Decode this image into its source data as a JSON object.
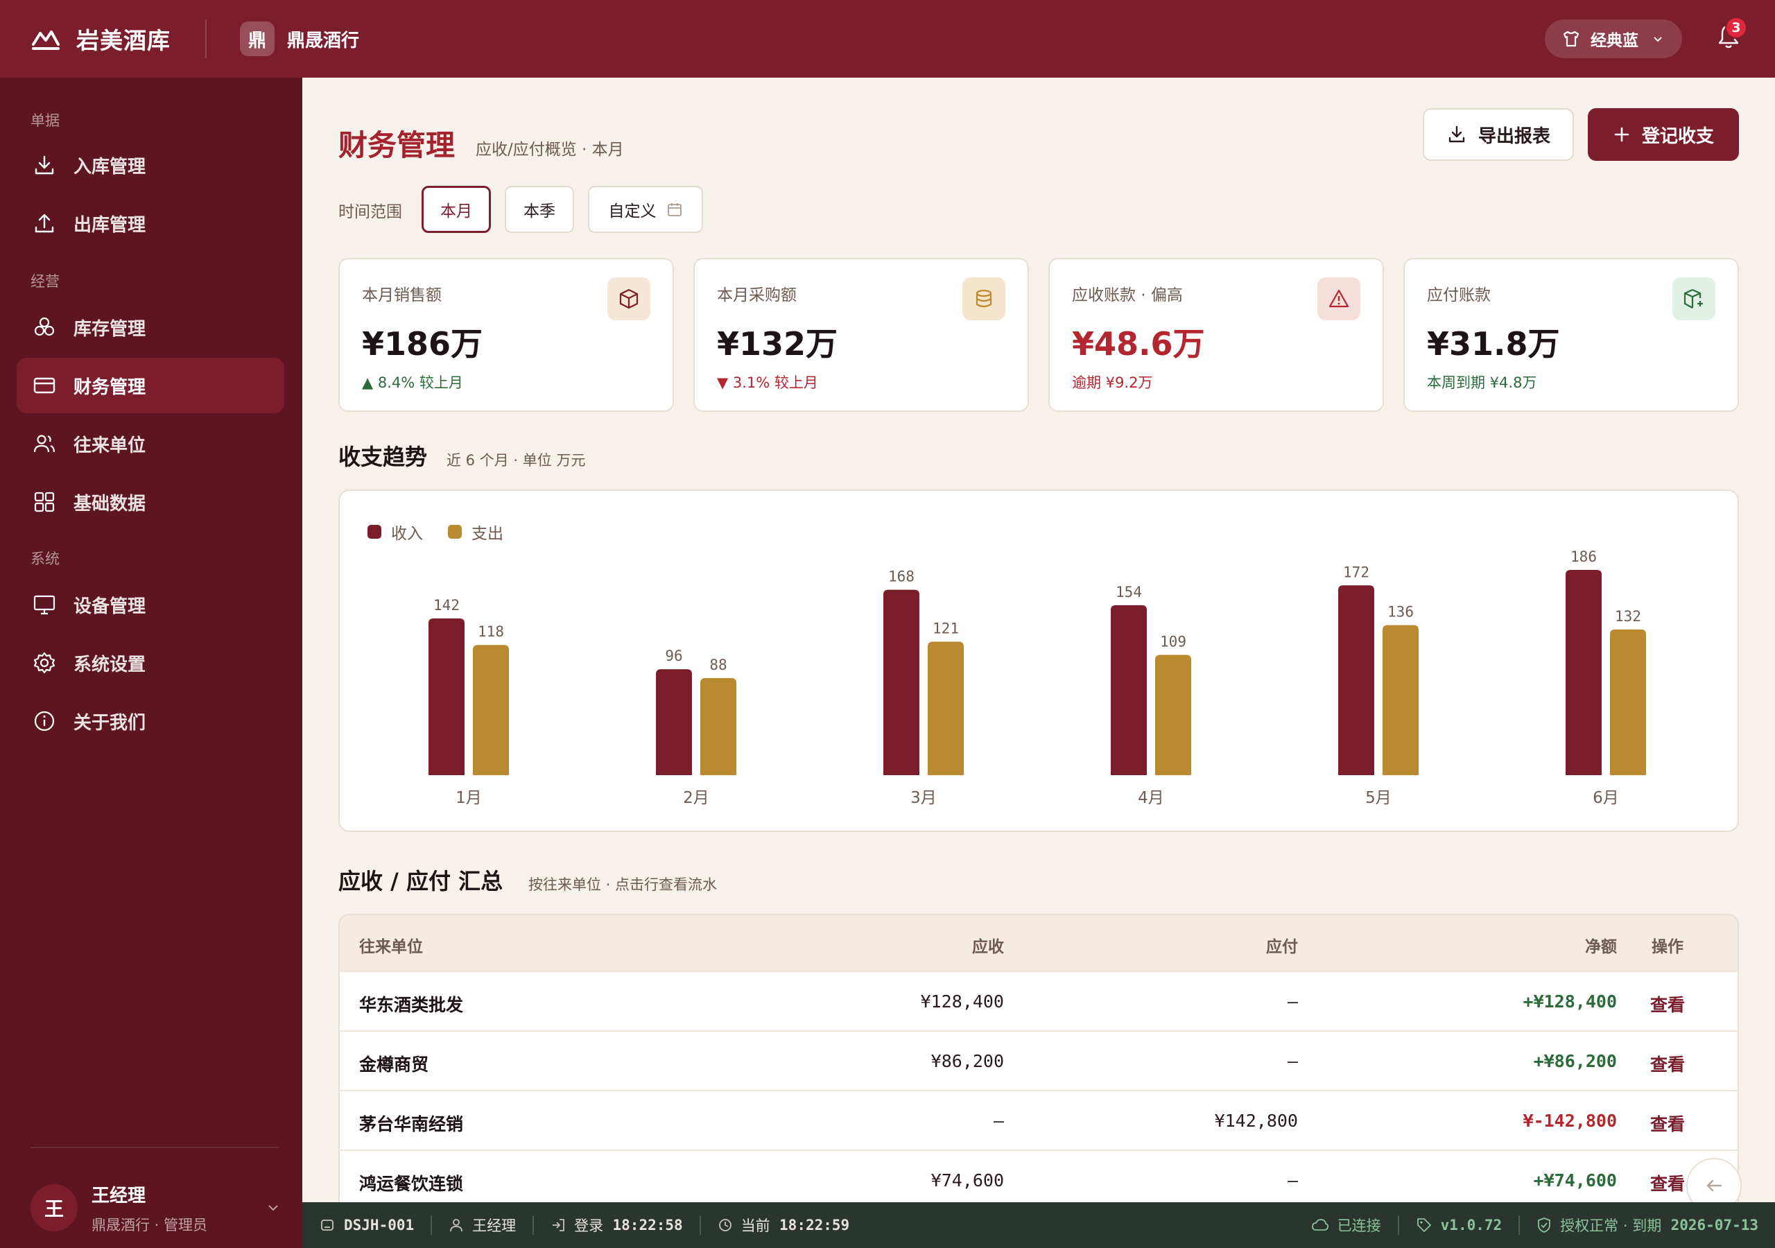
{
  "app": {
    "name": "岩美酒库",
    "shop_initial": "鼎",
    "shop_name": "鼎晟酒行",
    "theme_label": "经典蓝",
    "notifications": "3"
  },
  "sidebar": {
    "sections": [
      "单据",
      "经营",
      "系统"
    ],
    "items": [
      {
        "label": "入库管理",
        "icon": "download-icon"
      },
      {
        "label": "出库管理",
        "icon": "upload-icon"
      },
      {
        "label": "库存管理",
        "icon": "boxes-icon"
      },
      {
        "label": "财务管理",
        "icon": "card-icon",
        "active": true
      },
      {
        "label": "往来单位",
        "icon": "users-icon"
      },
      {
        "label": "基础数据",
        "icon": "grid-icon"
      },
      {
        "label": "设备管理",
        "icon": "monitor-icon"
      },
      {
        "label": "系统设置",
        "icon": "gear-icon"
      },
      {
        "label": "关于我们",
        "icon": "info-icon"
      }
    ],
    "user": {
      "initial": "王",
      "name": "王经理",
      "role": "鼎晟酒行 · 管理员"
    }
  },
  "page": {
    "title": "财务管理",
    "subtitle": "应收/应付概览 · 本月",
    "export_label": "导出报表",
    "record_label": "登记收支",
    "range_label": "时间范围",
    "ranges": [
      "本月",
      "本季",
      "自定义"
    ]
  },
  "kpis": [
    {
      "label": "本月销售额",
      "value": "¥186万",
      "foot": "▲ 8.4% 较上月",
      "icon": "box-icon"
    },
    {
      "label": "本月采购额",
      "value": "¥132万",
      "foot": "▼ 3.1% 较上月",
      "icon": "database-icon"
    },
    {
      "label": "应收账款 · 偏高",
      "value": "¥48.6万",
      "foot": "逾期 ¥9.2万",
      "icon": "warning-icon"
    },
    {
      "label": "应付账款",
      "value": "¥31.8万",
      "foot": "本周到期 ¥4.8万",
      "icon": "package-check-icon"
    }
  ],
  "trend": {
    "title": "收支趋势",
    "subtitle": "近 6 个月 · 单位 万元"
  },
  "chart_data": {
    "type": "bar",
    "categories": [
      "1月",
      "2月",
      "3月",
      "4月",
      "5月",
      "6月"
    ],
    "series": [
      {
        "name": "收入",
        "values": [
          142,
          96,
          168,
          154,
          172,
          186
        ],
        "color": "#7b1d2b"
      },
      {
        "name": "支出",
        "values": [
          118,
          88,
          121,
          109,
          136,
          132
        ],
        "color": "#b98a2f"
      }
    ],
    "ylim": [
      0,
      186
    ],
    "title": "",
    "xlabel": "",
    "ylabel": ""
  },
  "summary": {
    "title": "应收 / 应付 汇总",
    "subtitle": "按往来单位 · 点击行查看流水",
    "columns": [
      "往来单位",
      "应收",
      "应付",
      "净额",
      "操作"
    ],
    "rows": [
      {
        "name": "华东酒类批发",
        "recv": "¥128,400",
        "pay": "—",
        "net": "+¥128,400",
        "action": "查看"
      },
      {
        "name": "金樽商贸",
        "recv": "¥86,200",
        "pay": "—",
        "net": "+¥86,200",
        "action": "查看"
      },
      {
        "name": "茅台华南经销",
        "recv": "—",
        "pay": "¥142,800",
        "net": "¥-142,800",
        "action": "查看"
      },
      {
        "name": "鸿运餐饮连锁",
        "recv": "¥74,600",
        "pay": "—",
        "net": "+¥74,600",
        "action": "查看"
      }
    ]
  },
  "status": {
    "device": "DSJH-001",
    "user": "王经理",
    "login_label": "登录",
    "login_time": "18:22:58",
    "now_label": "当前",
    "now_time": "18:22:59",
    "conn": "已连接",
    "version": "v1.0.72",
    "license": "授权正常 · 到期",
    "expire": "2026-07-13"
  }
}
